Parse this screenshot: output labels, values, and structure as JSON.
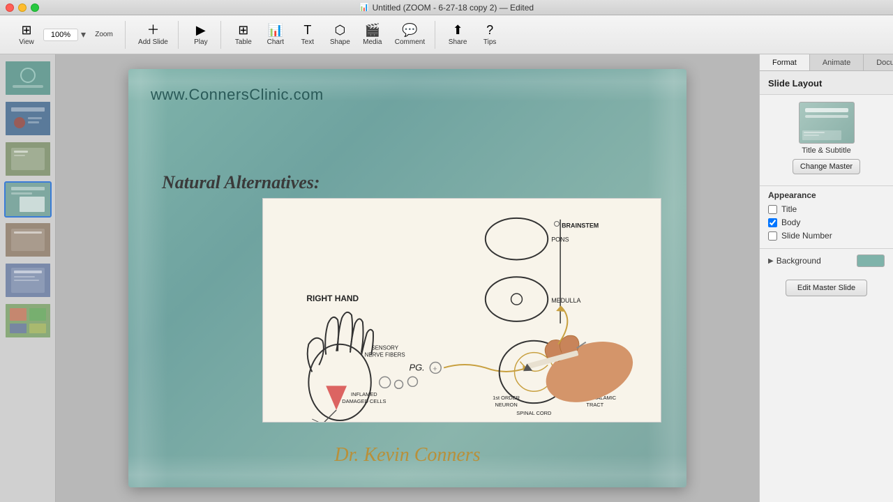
{
  "titlebar": {
    "title": "Untitled (ZOOM - 6-27-18 copy 2) — Edited",
    "icon": "📊"
  },
  "toolbar": {
    "zoom_value": "100%",
    "zoom_label": "Zoom",
    "add_slide_label": "Add Slide",
    "play_label": "Play",
    "table_label": "Table",
    "chart_label": "Chart",
    "text_label": "Text",
    "shape_label": "Shape",
    "media_label": "Media",
    "comment_label": "Comment",
    "share_label": "Share",
    "tips_label": "Tips"
  },
  "tabs": [
    {
      "label": "Format",
      "active": true
    },
    {
      "label": "Animate",
      "active": false
    },
    {
      "label": "Document",
      "active": false
    }
  ],
  "slide_panel": {
    "slides": [
      {
        "id": 1,
        "thumb_class": "thumb-1"
      },
      {
        "id": 2,
        "thumb_class": "thumb-2"
      },
      {
        "id": 3,
        "thumb_class": "thumb-3"
      },
      {
        "id": 4,
        "thumb_class": "thumb-4",
        "active": true
      },
      {
        "id": 5,
        "thumb_class": "thumb-5"
      },
      {
        "id": 6,
        "thumb_class": "thumb-6"
      },
      {
        "id": 7,
        "thumb_class": "thumb-7"
      }
    ]
  },
  "slide": {
    "url": "www.ConnersClinic.com",
    "subtitle": "Natural Alternatives:",
    "author": "Dr. Kevin Conners"
  },
  "right_panel": {
    "title": "Slide Layout",
    "layout_name": "Title & Subtitle",
    "change_master_label": "Change Master",
    "appearance_title": "Appearance",
    "checkboxes": [
      {
        "id": "title",
        "label": "Title",
        "checked": false
      },
      {
        "id": "body",
        "label": "Body",
        "checked": true
      },
      {
        "id": "slide_number",
        "label": "Slide Number",
        "checked": false
      }
    ],
    "background_label": "Background",
    "background_color": "#7fb3aa",
    "edit_master_label": "Edit Master Slide"
  }
}
